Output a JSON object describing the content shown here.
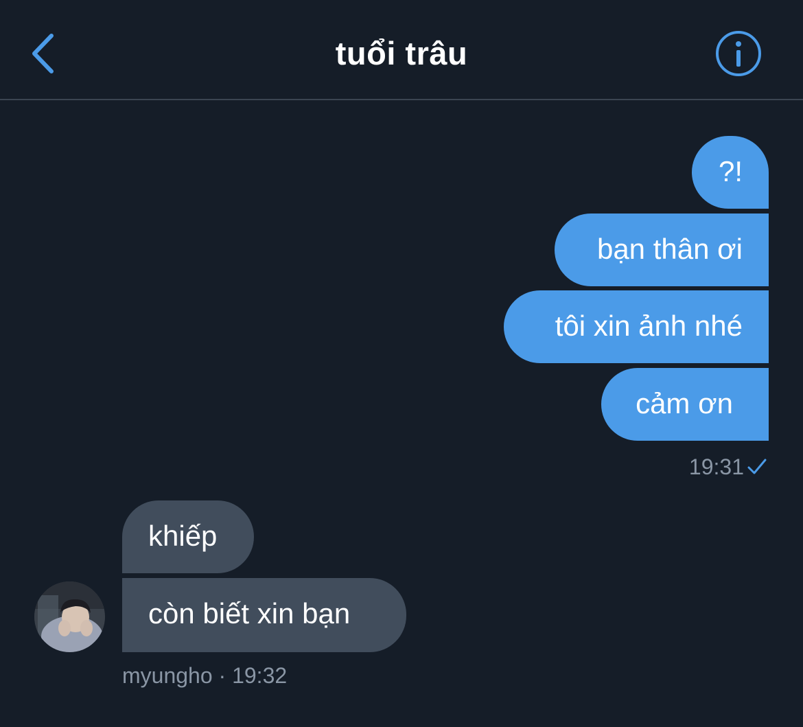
{
  "header": {
    "title": "tuổi trâu",
    "back_icon": "chevron-left-icon",
    "info_icon": "info-icon"
  },
  "colors": {
    "background": "#151d28",
    "outgoing_bubble": "#4b9be8",
    "incoming_bubble": "#414d5c",
    "accent": "#4b9be8",
    "meta_text": "#8a96a5"
  },
  "outgoing": {
    "messages": [
      "?!",
      "bạn thân ơi",
      "tôi xin ảnh nhé",
      "cảm ơn"
    ],
    "time": "19:31",
    "status_icon": "checkmark-icon"
  },
  "incoming": {
    "messages": [
      "khiếp",
      "còn biết xin bạn"
    ],
    "meta": "myungho · 19:32",
    "avatar_icon": "avatar"
  }
}
